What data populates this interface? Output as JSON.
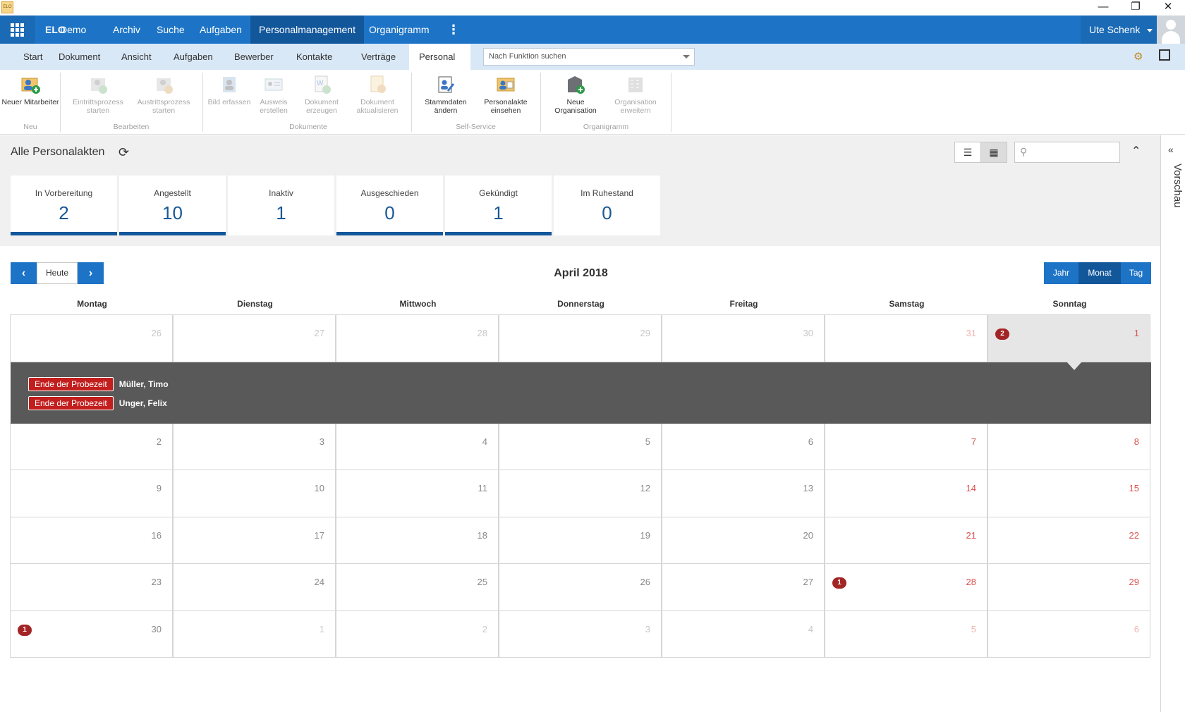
{
  "window": {
    "icon": "ELO",
    "minimize": "—",
    "restore": "❐",
    "close": "✕"
  },
  "topbar": {
    "brand": "ELO",
    "brand_suffix": "Demo",
    "nav": [
      "Archiv",
      "Suche",
      "Aufgaben",
      "Personalmanagement",
      "Organigramm"
    ],
    "active_nav": "Personalmanagement",
    "more_icon": "⋮",
    "user": "Ute Schenk"
  },
  "ribbon_tabs": {
    "tabs": [
      "Start",
      "Dokument",
      "Ansicht",
      "Aufgaben",
      "Bewerber",
      "Kontakte",
      "Verträge",
      "Personal"
    ],
    "active": "Personal",
    "function_search_placeholder": "Nach Funktion suchen"
  },
  "ribbon": {
    "groups": [
      {
        "label": "Neu",
        "buttons": [
          {
            "label": "Neuer Mitarbeiter",
            "enabled": true,
            "icon": "new-employee-icon"
          }
        ]
      },
      {
        "label": "Bearbeiten",
        "buttons": [
          {
            "label": "Eintrittsprozess starten",
            "enabled": false,
            "icon": "entry-process-icon"
          },
          {
            "label": "Austrittsprozess starten",
            "enabled": false,
            "icon": "exit-process-icon"
          }
        ]
      },
      {
        "label": "Dokumente",
        "buttons": [
          {
            "label": "Bild erfassen",
            "enabled": false,
            "icon": "capture-photo-icon"
          },
          {
            "label": "Ausweis erstellen",
            "enabled": false,
            "icon": "id-card-icon"
          },
          {
            "label": "Dokument erzeugen",
            "enabled": false,
            "icon": "create-document-icon"
          },
          {
            "label": "Dokument aktualisieren",
            "enabled": false,
            "icon": "update-document-icon"
          }
        ]
      },
      {
        "label": "Self-Service",
        "buttons": [
          {
            "label": "Stammdaten ändern",
            "enabled": true,
            "icon": "edit-master-data-icon"
          },
          {
            "label": "Personalakte einsehen",
            "enabled": true,
            "icon": "view-personnel-file-icon"
          }
        ]
      },
      {
        "label": "Organigramm",
        "buttons": [
          {
            "label": "Neue Organisation",
            "enabled": true,
            "icon": "new-organization-icon"
          },
          {
            "label": "Organisation erweitern",
            "enabled": false,
            "icon": "extend-organization-icon"
          }
        ]
      }
    ]
  },
  "header": {
    "title": "Alle Personalakten",
    "refresh_icon": "⟳",
    "list_icon": "☰",
    "calendar_icon": "▦",
    "search_icon": "⚲",
    "collapse_icon": "⌃"
  },
  "status_cards": [
    {
      "label": "In Vorbereitung",
      "value": "2",
      "selected": true
    },
    {
      "label": "Angestellt",
      "value": "10",
      "selected": true
    },
    {
      "label": "Inaktiv",
      "value": "1",
      "selected": false
    },
    {
      "label": "Ausgeschieden",
      "value": "0",
      "selected": true
    },
    {
      "label": "Gekündigt",
      "value": "1",
      "selected": true
    },
    {
      "label": "Im Ruhestand",
      "value": "0",
      "selected": false
    }
  ],
  "calendar": {
    "title": "April 2018",
    "prev_icon": "‹",
    "next_icon": "›",
    "today_label": "Heute",
    "modes": [
      "Jahr",
      "Monat",
      "Tag"
    ],
    "active_mode": "Monat",
    "weekdays": [
      "Montag",
      "Dienstag",
      "Mittwoch",
      "Donnerstag",
      "Freitag",
      "Samstag",
      "Sonntag"
    ],
    "weeks": [
      [
        {
          "d": "26",
          "o": true
        },
        {
          "d": "27",
          "o": true
        },
        {
          "d": "28",
          "o": true
        },
        {
          "d": "29",
          "o": true
        },
        {
          "d": "30",
          "o": true
        },
        {
          "d": "31",
          "o": true
        },
        {
          "d": "1",
          "o": false,
          "badge": "2",
          "sel": true
        }
      ],
      [
        {
          "d": "2"
        },
        {
          "d": "3"
        },
        {
          "d": "4"
        },
        {
          "d": "5"
        },
        {
          "d": "6"
        },
        {
          "d": "7"
        },
        {
          "d": "8"
        }
      ],
      [
        {
          "d": "9"
        },
        {
          "d": "10"
        },
        {
          "d": "11"
        },
        {
          "d": "12"
        },
        {
          "d": "13"
        },
        {
          "d": "14"
        },
        {
          "d": "15"
        }
      ],
      [
        {
          "d": "16"
        },
        {
          "d": "17"
        },
        {
          "d": "18"
        },
        {
          "d": "19"
        },
        {
          "d": "20"
        },
        {
          "d": "21"
        },
        {
          "d": "22"
        }
      ],
      [
        {
          "d": "23"
        },
        {
          "d": "24"
        },
        {
          "d": "25"
        },
        {
          "d": "26"
        },
        {
          "d": "27"
        },
        {
          "d": "28",
          "badge": "1"
        },
        {
          "d": "29"
        }
      ],
      [
        {
          "d": "30",
          "badge": "1"
        },
        {
          "d": "1",
          "o": true
        },
        {
          "d": "2",
          "o": true
        },
        {
          "d": "3",
          "o": true
        },
        {
          "d": "4",
          "o": true
        },
        {
          "d": "5",
          "o": true
        },
        {
          "d": "6",
          "o": true
        }
      ]
    ],
    "events": [
      {
        "type": "Ende der Probezeit",
        "person": "Müller, Timo"
      },
      {
        "type": "Ende der Probezeit",
        "person": "Unger, Felix"
      }
    ]
  },
  "preview": {
    "label": "Vorschau",
    "expand_icon": "«"
  },
  "colors": {
    "primary": "#1d74c6",
    "primary_dark": "#13579b",
    "event_red": "#c21e1e",
    "badge_red": "#a32424"
  }
}
